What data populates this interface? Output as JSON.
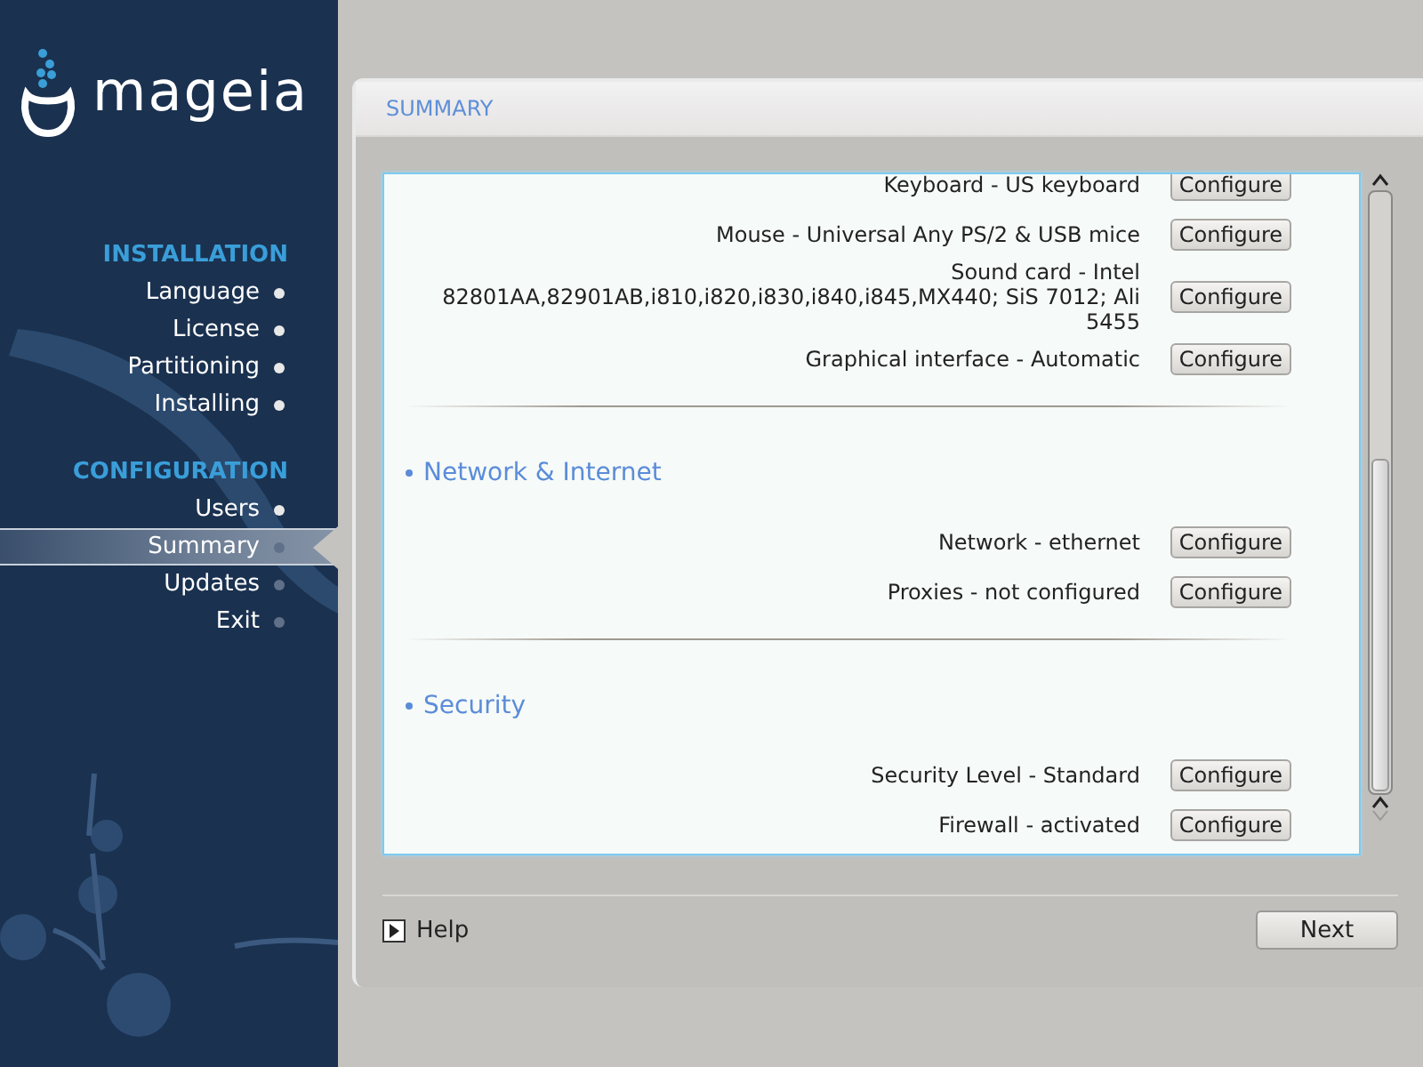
{
  "logo": {
    "text": "mageia"
  },
  "sidebar": {
    "groups": [
      {
        "title": "INSTALLATION",
        "items": [
          {
            "label": "Language",
            "selected": false,
            "done": true
          },
          {
            "label": "License",
            "selected": false,
            "done": true
          },
          {
            "label": "Partitioning",
            "selected": false,
            "done": true
          },
          {
            "label": "Installing",
            "selected": false,
            "done": true
          }
        ]
      },
      {
        "title": "CONFIGURATION",
        "items": [
          {
            "label": "Users",
            "selected": false,
            "done": true
          },
          {
            "label": "Summary",
            "selected": true,
            "done": false
          },
          {
            "label": "Updates",
            "selected": false,
            "done": false
          },
          {
            "label": "Exit",
            "selected": false,
            "done": false
          }
        ]
      }
    ]
  },
  "panel": {
    "title": "SUMMARY",
    "sections": [
      {
        "items": [
          {
            "label": "Keyboard - US keyboard",
            "button": "Configure"
          },
          {
            "label": "Mouse - Universal Any PS/2 & USB mice",
            "button": "Configure"
          },
          {
            "label": "Sound card - Intel 82801AA,82901AB,i810,i820,i830,i840,i845,MX440; SiS 7012; Ali 5455",
            "button": "Configure"
          },
          {
            "label": "Graphical interface - Automatic",
            "button": "Configure"
          }
        ]
      },
      {
        "heading": "Network & Internet",
        "items": [
          {
            "label": "Network - ethernet",
            "button": "Configure"
          },
          {
            "label": "Proxies - not configured",
            "button": "Configure"
          }
        ]
      },
      {
        "heading": "Security",
        "items": [
          {
            "label": "Security Level - Standard",
            "button": "Configure"
          },
          {
            "label": "Firewall - activated",
            "button": "Configure"
          }
        ]
      }
    ]
  },
  "footer": {
    "help": "Help",
    "next": "Next"
  }
}
